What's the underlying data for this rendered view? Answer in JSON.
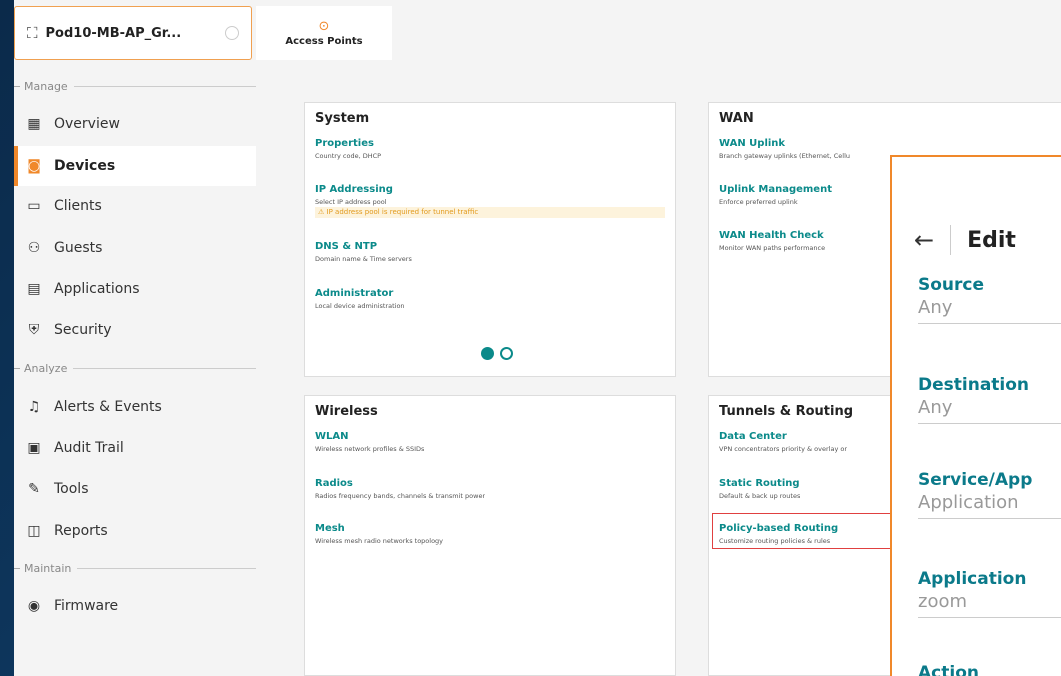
{
  "sidebar": {
    "group_name": "Pod10-MB-AP_Gr...",
    "sections": {
      "manage": "Manage",
      "analyze": "Analyze",
      "maintain": "Maintain"
    },
    "items": [
      {
        "label": "Overview",
        "icon": "grid-icon"
      },
      {
        "label": "Devices",
        "icon": "devices-icon",
        "active": true
      },
      {
        "label": "Clients",
        "icon": "clients-icon"
      },
      {
        "label": "Guests",
        "icon": "guests-icon"
      },
      {
        "label": "Applications",
        "icon": "applications-icon"
      },
      {
        "label": "Security",
        "icon": "shield-icon"
      },
      {
        "label": "Alerts & Events",
        "icon": "bell-icon"
      },
      {
        "label": "Audit Trail",
        "icon": "audit-icon"
      },
      {
        "label": "Tools",
        "icon": "wrench-icon"
      },
      {
        "label": "Reports",
        "icon": "reports-icon"
      },
      {
        "label": "Firmware",
        "icon": "firmware-icon"
      }
    ]
  },
  "tabs": [
    {
      "label": "Access Points",
      "icon": "access-point-icon"
    }
  ],
  "cards": {
    "system": {
      "title": "System",
      "links": [
        {
          "label": "Properties",
          "desc": "Country code, DHCP"
        },
        {
          "label": "IP Addressing",
          "desc": "Select IP address pool",
          "warning": "IP address pool is required for tunnel traffic"
        },
        {
          "label": "DNS & NTP",
          "desc": "Domain name & Time servers"
        },
        {
          "label": "Administrator",
          "desc": "Local device administration"
        }
      ]
    },
    "wan": {
      "title": "WAN",
      "links": [
        {
          "label": "WAN Uplink",
          "desc": "Branch gateway uplinks (Ethernet, Cellu"
        },
        {
          "label": "Uplink Management",
          "desc": "Enforce preferred uplink"
        },
        {
          "label": "WAN Health Check",
          "desc": "Monitor WAN paths performance"
        }
      ]
    },
    "wireless": {
      "title": "Wireless",
      "links": [
        {
          "label": "WLAN",
          "desc": "Wireless network profiles & SSIDs"
        },
        {
          "label": "Radios",
          "desc": "Radios frequency bands, channels & transmit power"
        },
        {
          "label": "Mesh",
          "desc": "Wireless mesh radio networks topology"
        }
      ]
    },
    "tunnels": {
      "title": "Tunnels & Routing",
      "links": [
        {
          "label": "Data Center",
          "desc": "VPN concentrators priority & overlay or"
        },
        {
          "label": "Static Routing",
          "desc": "Default & back up routes"
        },
        {
          "label": "Policy-based Routing",
          "desc": "Customize routing policies & rules"
        }
      ]
    }
  },
  "edit_panel": {
    "title": "Edit",
    "fields": [
      {
        "label": "Source",
        "value": "Any"
      },
      {
        "label": "Destination",
        "value": "Any"
      },
      {
        "label": "Service/App",
        "value": "Application"
      },
      {
        "label": "Application",
        "value": "zoom"
      },
      {
        "label": "Action",
        "value": ""
      }
    ]
  },
  "colors": {
    "accent": "#f0882a",
    "link": "#0b8a8a",
    "warning": "#e29a1c",
    "highlight": "#e04040"
  }
}
